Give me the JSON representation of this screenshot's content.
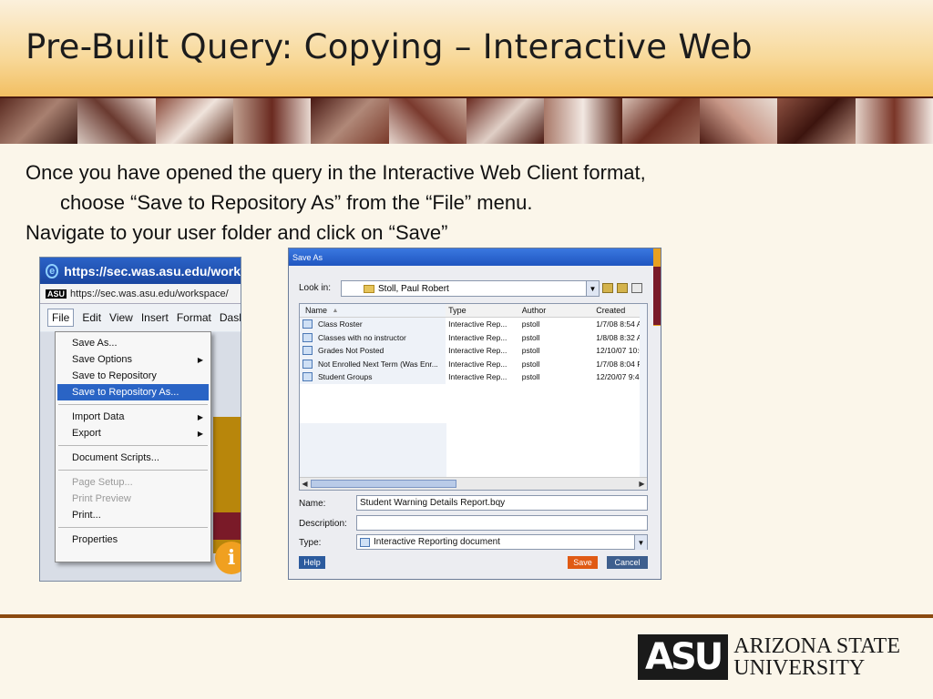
{
  "slide": {
    "title": "Pre-Built Query: Copying – Interactive Web",
    "bullet1_line1": "Once you have opened the query in the Interactive Web Client format,",
    "bullet1_line2": "choose “Save to Repository As” from the “File” menu.",
    "bullet2": "Navigate to your user folder and click on “Save”"
  },
  "browser": {
    "title": "https://sec.was.asu.edu/work",
    "address": "https://sec.was.asu.edu/workspace/",
    "address_logo": "ASU",
    "menubar": [
      "File",
      "Edit",
      "View",
      "Insert",
      "Format",
      "Dashb"
    ]
  },
  "file_menu": {
    "items": [
      {
        "label": "Save As...",
        "state": "normal"
      },
      {
        "label": "Save Options",
        "state": "normal",
        "submenu": true
      },
      {
        "label": "Save to Repository",
        "state": "normal"
      },
      {
        "label": "Save to Repository As...",
        "state": "selected"
      },
      {
        "label": "Import Data",
        "state": "normal",
        "submenu": true
      },
      {
        "label": "Export",
        "state": "normal",
        "submenu": true
      },
      {
        "label": "Document Scripts...",
        "state": "normal"
      },
      {
        "label": "Page Setup...",
        "state": "disabled"
      },
      {
        "label": "Print Preview",
        "state": "disabled"
      },
      {
        "label": "Print...",
        "state": "normal"
      },
      {
        "label": "Properties",
        "state": "normal"
      }
    ]
  },
  "save_dialog": {
    "title": "Save As",
    "look_in_label": "Look in:",
    "look_in_value": "Stoll, Paul Robert",
    "columns": [
      "Name",
      "Type",
      "Author",
      "Created"
    ],
    "rows": [
      {
        "name": "Class Roster",
        "type": "Interactive Rep...",
        "author": "pstoll",
        "created": "1/7/08 8:54 Al"
      },
      {
        "name": "Classes with no instructor",
        "type": "Interactive Rep...",
        "author": "pstoll",
        "created": "1/8/08 8:32 Al"
      },
      {
        "name": "Grades Not Posted",
        "type": "Interactive Rep...",
        "author": "pstoll",
        "created": "12/10/07 10:0"
      },
      {
        "name": "Not Enrolled Next Term (Was Enr...",
        "type": "Interactive Rep...",
        "author": "pstoll",
        "created": "1/7/08 8:04 Pl"
      },
      {
        "name": "Student Groups",
        "type": "Interactive Rep...",
        "author": "pstoll",
        "created": "12/20/07 9:41"
      }
    ],
    "name_label": "Name:",
    "name_value": "Student Warning Details Report.bqy",
    "description_label": "Description:",
    "description_value": "",
    "type_label": "Type:",
    "type_value": "Interactive Reporting document",
    "help_label": "Help",
    "save_label": "Save",
    "cancel_label": "Cancel"
  },
  "logo": {
    "mark": "ASU",
    "line1": "ARIZONA STATE",
    "line2": "UNIVERSITY"
  },
  "colors": {
    "title_gradient_top": "#fbf0dc",
    "title_gradient_bottom": "#f2bf62",
    "rule": "#8b4a10",
    "menu_selection": "#2a64c5",
    "save_button": "#e05a14"
  }
}
